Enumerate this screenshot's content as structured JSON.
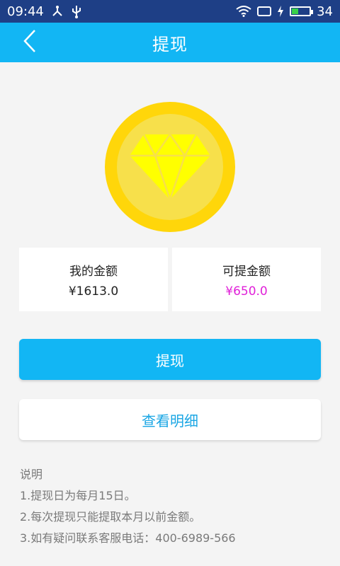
{
  "status_bar": {
    "time": "09:44",
    "battery_level": "34",
    "battery_fraction": 0.34,
    "icons": [
      "usb-debug-icon",
      "usb-icon",
      "wifi-icon",
      "screen-cast-icon",
      "charging-icon",
      "battery-icon"
    ]
  },
  "header": {
    "title": "提现",
    "back_icon": "chevron-left-icon"
  },
  "hero": {
    "icon": "diamond-icon",
    "coin_color": "#ffd60a",
    "diamond_color": "#ffff00"
  },
  "balance_cards": [
    {
      "label": "我的金额",
      "value": "¥1613.0"
    },
    {
      "label": "可提金额",
      "value": "¥650.0"
    }
  ],
  "actions": {
    "withdraw_label": "提现",
    "details_label": "查看明细"
  },
  "notes": {
    "title": "说明",
    "items": [
      "1.提现日为每月15日。",
      "2.每次提现只能提取本月以前金额。",
      "3.如有疑问联系客服电话：400-6989-566"
    ]
  },
  "colors": {
    "accent": "#12b6f4",
    "status_bar": "#1e3f86",
    "highlight_value": "#e020d8",
    "link_text": "#1aa6e4"
  }
}
